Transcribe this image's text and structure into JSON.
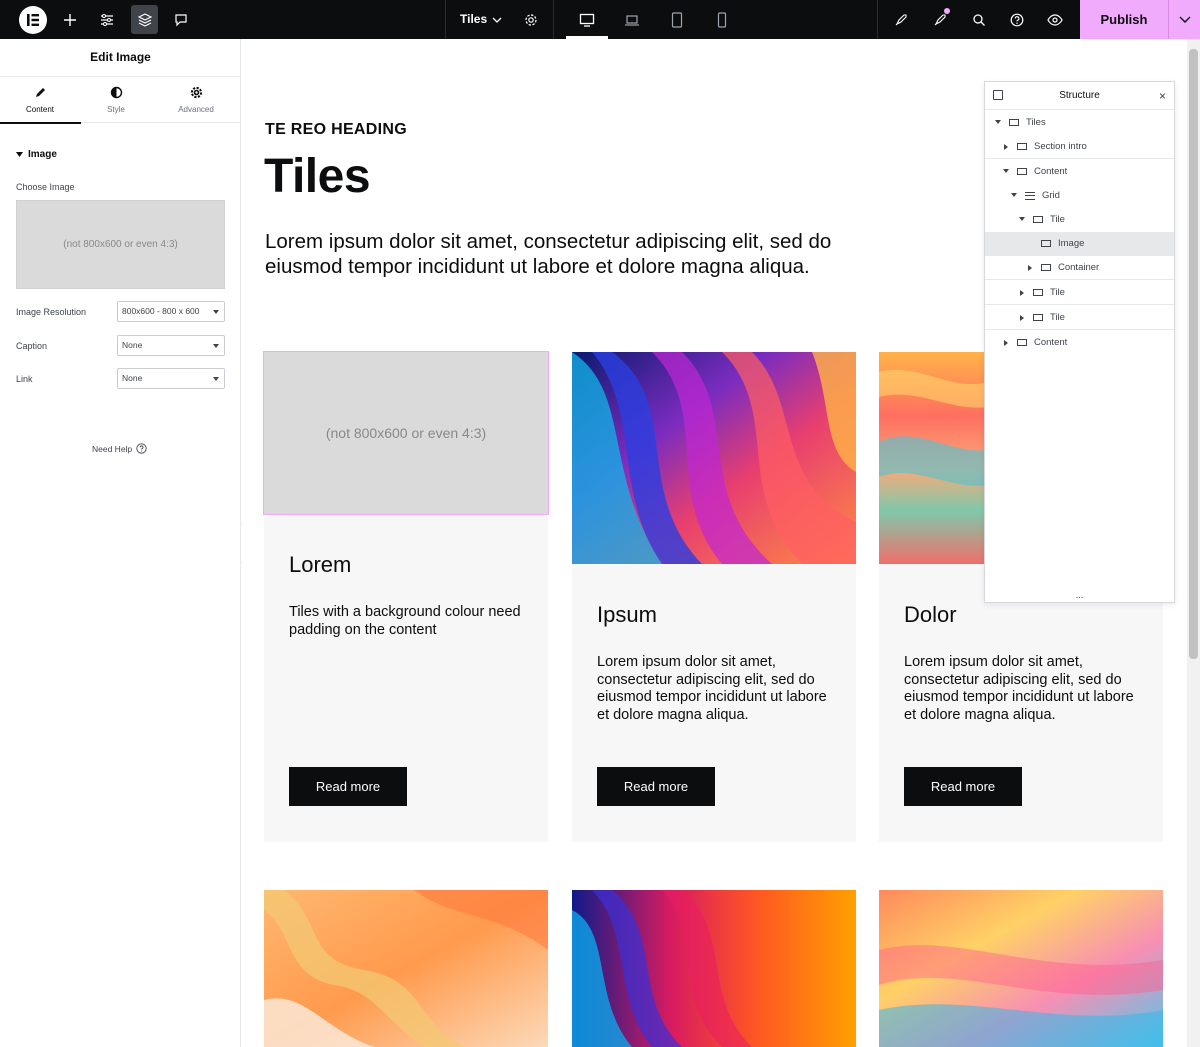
{
  "topbar": {
    "page_name": "Tiles",
    "publish_label": "Publish",
    "icons": [
      "elementor-logo-icon",
      "add-element-icon",
      "site-settings-icon",
      "structure-layers-icon",
      "comments-icon",
      "page-settings-icon",
      "desktop-icon",
      "laptop-icon",
      "tablet-icon",
      "mobile-icon",
      "launchpad-icon",
      "notes-icon",
      "finder-search-icon",
      "help-icon",
      "preview-eye-icon",
      "chevron-down-icon"
    ]
  },
  "panel": {
    "title": "Edit Image",
    "tabs": [
      {
        "label": "Content",
        "icon": "pencil-icon",
        "active": true
      },
      {
        "label": "Style",
        "icon": "half-circle-icon",
        "active": false
      },
      {
        "label": "Advanced",
        "icon": "gear-icon",
        "active": false
      }
    ],
    "section_title": "Image",
    "choose_image_label": "Choose Image",
    "image_placeholder_text": "(not 800x600 or even 4:3)",
    "resolution_label": "Image Resolution",
    "resolution_value": "800x600 - 800 x 600",
    "caption_label": "Caption",
    "caption_value": "None",
    "link_label": "Link",
    "link_value": "None",
    "need_help": "Need Help"
  },
  "canvas": {
    "eyebrow": "TE REO HEADING",
    "heading": "Tiles",
    "lead": "Lorem ipsum dolor sit amet, consectetur adipiscing elit, sed do eiusmod tempor incididunt ut labore et dolore magna aliqua.",
    "tiles": [
      {
        "title": "Lorem",
        "text": "Tiles with a background colour need padding on the content",
        "button": "Read more",
        "placeholder": "(not 800x600 or even 4:3)"
      },
      {
        "title": "Ipsum",
        "text": "Lorem ipsum dolor sit amet, consectetur adipiscing elit, sed do eiusmod tempor incididunt ut labore et dolore magna aliqua.",
        "button": "Read more"
      },
      {
        "title": "Dolor",
        "text": "Lorem ipsum dolor sit amet, consectetur adipiscing elit, sed do eiusmod tempor incididunt ut labore et dolore magna aliqua.",
        "button": "Read more"
      }
    ]
  },
  "structure": {
    "title": "Structure",
    "close": "×",
    "more": "...",
    "items": [
      {
        "label": "Tiles"
      },
      {
        "label": "Section intro"
      },
      {
        "label": "Content"
      },
      {
        "label": "Grid"
      },
      {
        "label": "Tile"
      },
      {
        "label": "Image",
        "selected": true
      },
      {
        "label": "Container"
      },
      {
        "label": "Tile"
      },
      {
        "label": "Tile"
      },
      {
        "label": "Content"
      }
    ]
  },
  "colors": {
    "accent": "#f0abfc",
    "topbar": "#0c0d0e",
    "tile_bg": "#f7f7f7"
  }
}
